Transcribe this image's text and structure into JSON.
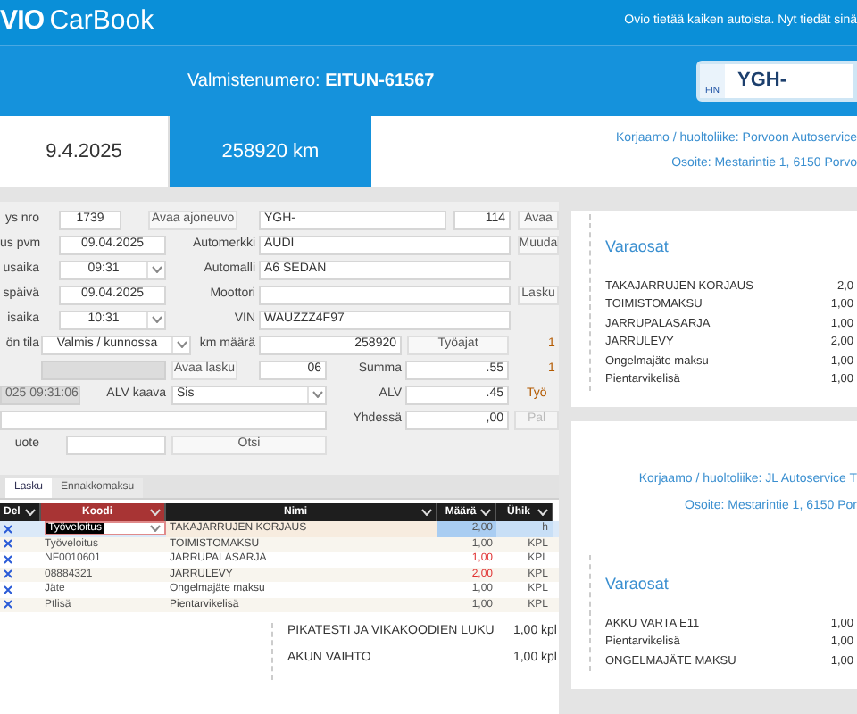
{
  "header": {
    "logo_prefix": "VIO",
    "logo": "CarBook",
    "tagline": "Ovio tietää kaiken autoista. Nyt tiedät sinä"
  },
  "vehicle_bar": {
    "vin_label": "Valmistenumero: **EITUN-61567**",
    "plate_country": "FIN",
    "plate": "YGH-"
  },
  "visit": {
    "date": "9.4.2025",
    "mileage": "258920 km",
    "workshop": "Korjaamo / huoltoliike: Porvoon Autoservice",
    "address": "Osoite: Mestarintie 1, 6150 Porvo"
  },
  "form": {
    "rows": [
      [
        {
          "kind": "label",
          "text": "ys nro"
        },
        {
          "kind": "field",
          "value": "1739",
          "disabled": false
        },
        {
          "kind": "button",
          "label": "Avaa ajoneuvo",
          "disabled": false
        },
        {
          "kind": "field",
          "value": "YGH-",
          "disabled": false
        },
        {
          "kind": "field",
          "value": "114",
          "disabled": false
        },
        {
          "kind": "button",
          "label": "Avaa",
          "disabled": false
        }
      ],
      [
        {
          "kind": "label",
          "text": "us pvm"
        },
        {
          "kind": "field",
          "value": "09.04.2025",
          "disabled": false
        },
        {
          "kind": "label",
          "text": "Automerkki"
        },
        {
          "kind": "field",
          "value": "AUDI",
          "disabled": false
        },
        {
          "kind": "button",
          "label": "Muuda",
          "disabled": false
        }
      ],
      [
        {
          "kind": "label",
          "text": "usaika"
        },
        {
          "kind": "select",
          "value": "09:31"
        },
        {
          "kind": "label",
          "text": "Automalli"
        },
        {
          "kind": "field",
          "value": "A6 SEDAN",
          "disabled": false
        }
      ],
      [
        {
          "kind": "label",
          "text": "späivä"
        },
        {
          "kind": "field",
          "value": "09.04.2025",
          "disabled": false
        },
        {
          "kind": "label",
          "text": "Moottori"
        },
        {
          "kind": "field",
          "disabled": false
        },
        {
          "kind": "button",
          "label": "Lasku",
          "disabled": false
        }
      ],
      [
        {
          "kind": "label",
          "text": "isaika"
        },
        {
          "kind": "select",
          "value": "10:31"
        },
        {
          "kind": "label",
          "text": "VIN"
        },
        {
          "kind": "field",
          "value": "WAUZZZ4F97",
          "disabled": false
        }
      ],
      [
        {
          "kind": "label",
          "text": "ön tila"
        },
        {
          "kind": "select",
          "value": "Valmis / kunnossa"
        },
        {
          "kind": "label",
          "text": "km määrä"
        },
        {
          "kind": "field",
          "value": "258920",
          "disabled": false
        },
        {
          "kind": "button",
          "label": "Työajat",
          "disabled": false
        },
        {
          "kind": "text",
          "text": "1"
        }
      ],
      [
        {
          "kind": "field",
          "disabled": true
        },
        {
          "kind": "button",
          "label": "Avaa lasku",
          "disabled": false
        },
        {
          "kind": "field",
          "value": "06",
          "disabled": false
        },
        {
          "kind": "label",
          "text": "Summa"
        },
        {
          "kind": "field",
          "value": ".55",
          "disabled": false
        },
        {
          "kind": "text",
          "text": "1"
        }
      ],
      [
        {
          "kind": "field",
          "value": "025 09:31:06",
          "disabled": true
        },
        {
          "kind": "label",
          "text": "ALV kaava"
        },
        {
          "kind": "select",
          "value": "Sis"
        },
        {
          "kind": "label",
          "text": "ALV"
        },
        {
          "kind": "field",
          "value": ".45",
          "disabled": false
        },
        {
          "kind": "text",
          "text": "Työ"
        }
      ],
      [
        {
          "kind": "field",
          "disabled": false
        },
        {
          "kind": "label",
          "text": "Yhdessä"
        },
        {
          "kind": "field",
          "value": ",00",
          "disabled": false
        },
        {
          "kind": "button",
          "label": "Pal",
          "disabled": true
        }
      ],
      [
        {
          "kind": "label",
          "text": "uote"
        },
        {
          "kind": "field",
          "disabled": false
        },
        {
          "kind": "button",
          "label": "Otsi",
          "disabled": false
        }
      ]
    ],
    "tabs": [
      {
        "label": "Lasku",
        "selected": true
      },
      {
        "label": "Ennakkomaksu",
        "selected": false
      }
    ],
    "table": {
      "columns": [
        {
          "label": "Del",
          "selected": false
        },
        {
          "label": "Koodi",
          "selected": true
        },
        {
          "label": "Nimi",
          "selected": false
        },
        {
          "label": "Määrä",
          "selected": false
        },
        {
          "label": "Ühik",
          "selected": false
        }
      ],
      "rows": [
        {
          "code": "Työveloitus",
          "name": "TAKAJARRUJEN KORJAUS",
          "quantity": "2,00",
          "unit": "h",
          "selected": true,
          "flagged": false
        },
        {
          "code": "Työveloitus",
          "name": "TOIMISTOMAKSU",
          "quantity": "1,00",
          "unit": "KPL",
          "selected": false,
          "flagged": false
        },
        {
          "code": "NF0010601",
          "name": "JARRUPALASARJA",
          "quantity": "1,00",
          "unit": "KPL",
          "selected": false,
          "flagged": true
        },
        {
          "code": "08884321",
          "name": "JARRULEVY",
          "quantity": "2,00",
          "unit": "KPL",
          "selected": false,
          "flagged": true
        },
        {
          "code": "Jäte",
          "name": "Ongelmajäte maksu",
          "quantity": "1,00",
          "unit": "KPL",
          "selected": false,
          "flagged": false
        },
        {
          "code": "Ptlisä",
          "name": "Pientarvikelisä",
          "quantity": "1,00",
          "unit": "KPL",
          "selected": false,
          "flagged": false
        }
      ]
    }
  },
  "summary_lines": [
    {
      "name": "PIKATESTI JA VIKAKOODIEN LUKU",
      "quantity": "1,00 kpl"
    },
    {
      "name": "AKUN VAIHTO",
      "quantity": "1,00 kpl"
    }
  ],
  "cards": [
    {
      "title": "Varaosat",
      "items": [
        {
          "name": "TAKAJARRUJEN KORJAUS",
          "quantity": "2,0"
        },
        {
          "name": "TOIMISTOMAKSU",
          "quantity": "1,00"
        },
        {
          "name": "JARRUPALASARJA",
          "quantity": "1,00"
        },
        {
          "name": "JARRULEVY",
          "quantity": "2,00"
        },
        {
          "name": "Ongelmajäte maksu",
          "quantity": "1,00"
        },
        {
          "name": "Pientarvikelisä",
          "quantity": "1,00"
        }
      ]
    },
    {
      "workshop": "Korjaamo / huoltoliike: JL Autoservice T",
      "address": "Osoite: Mestarintie 1, 6150 Por",
      "title": "Varaosat",
      "items": [
        {
          "name": "AKKU VARTA E11",
          "quantity": "1,00"
        },
        {
          "name": "Pientarvikelisä",
          "quantity": "1,00"
        },
        {
          "name": "ONGELMAJÄTE MAKSU",
          "quantity": "1,00"
        }
      ]
    }
  ]
}
